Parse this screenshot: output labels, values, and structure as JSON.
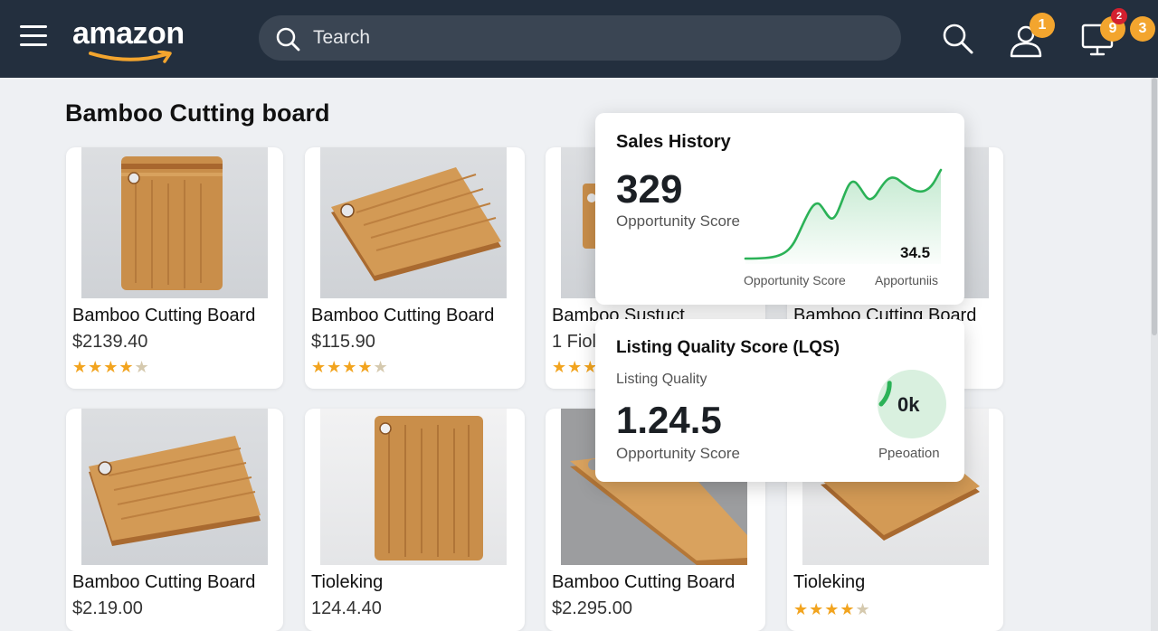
{
  "header": {
    "logo_text": "amazon",
    "search_placeholder": "Tearch",
    "user_badge": "1",
    "monitor_badge": "9",
    "monitor_badge_small": "2",
    "extra_badge": "3"
  },
  "page_title": "Bamboo Cutting board",
  "products": [
    {
      "title": "Bamboo Cutting Board",
      "price": "$2139.40",
      "rating": 4.5
    },
    {
      "title": "Bamboo Cutting Board",
      "price": "$115.90",
      "rating": 4.5
    },
    {
      "title": "Bamboo Sustuct",
      "price": "1 Fiole",
      "rating": 3
    },
    {
      "title": "Bamboo Cutting Board",
      "price": "",
      "rating": null
    },
    {
      "title": "Bamboo Cutting Board",
      "price": "$2.19.00",
      "rating": null
    },
    {
      "title": "Tioleking",
      "price": "124.4.40",
      "rating": null
    },
    {
      "title": "Bamboo Cutting Board",
      "price": "$2.295.00",
      "rating": null
    },
    {
      "title": "Tioleking",
      "price": "",
      "rating": 4.5
    }
  ],
  "sales_history": {
    "title": "Sales History",
    "value": "329",
    "value_label": "Opportunity Score",
    "chart_value": "34.5",
    "x_label_left": "Opportunity Score",
    "x_label_right": "Apportuniis"
  },
  "lqs": {
    "title": "Listing Quality Score (LQS)",
    "subtitle": "Listing Quality",
    "value": "1.24.5",
    "value_label": "Opportunity Score",
    "gauge_text": "0k",
    "gauge_label": "Ppeoation",
    "gauge_fraction": 0.12
  },
  "colors": {
    "header_bg": "#232f3e",
    "accent_orange": "#f3a52e",
    "chart_green": "#2bb257"
  }
}
